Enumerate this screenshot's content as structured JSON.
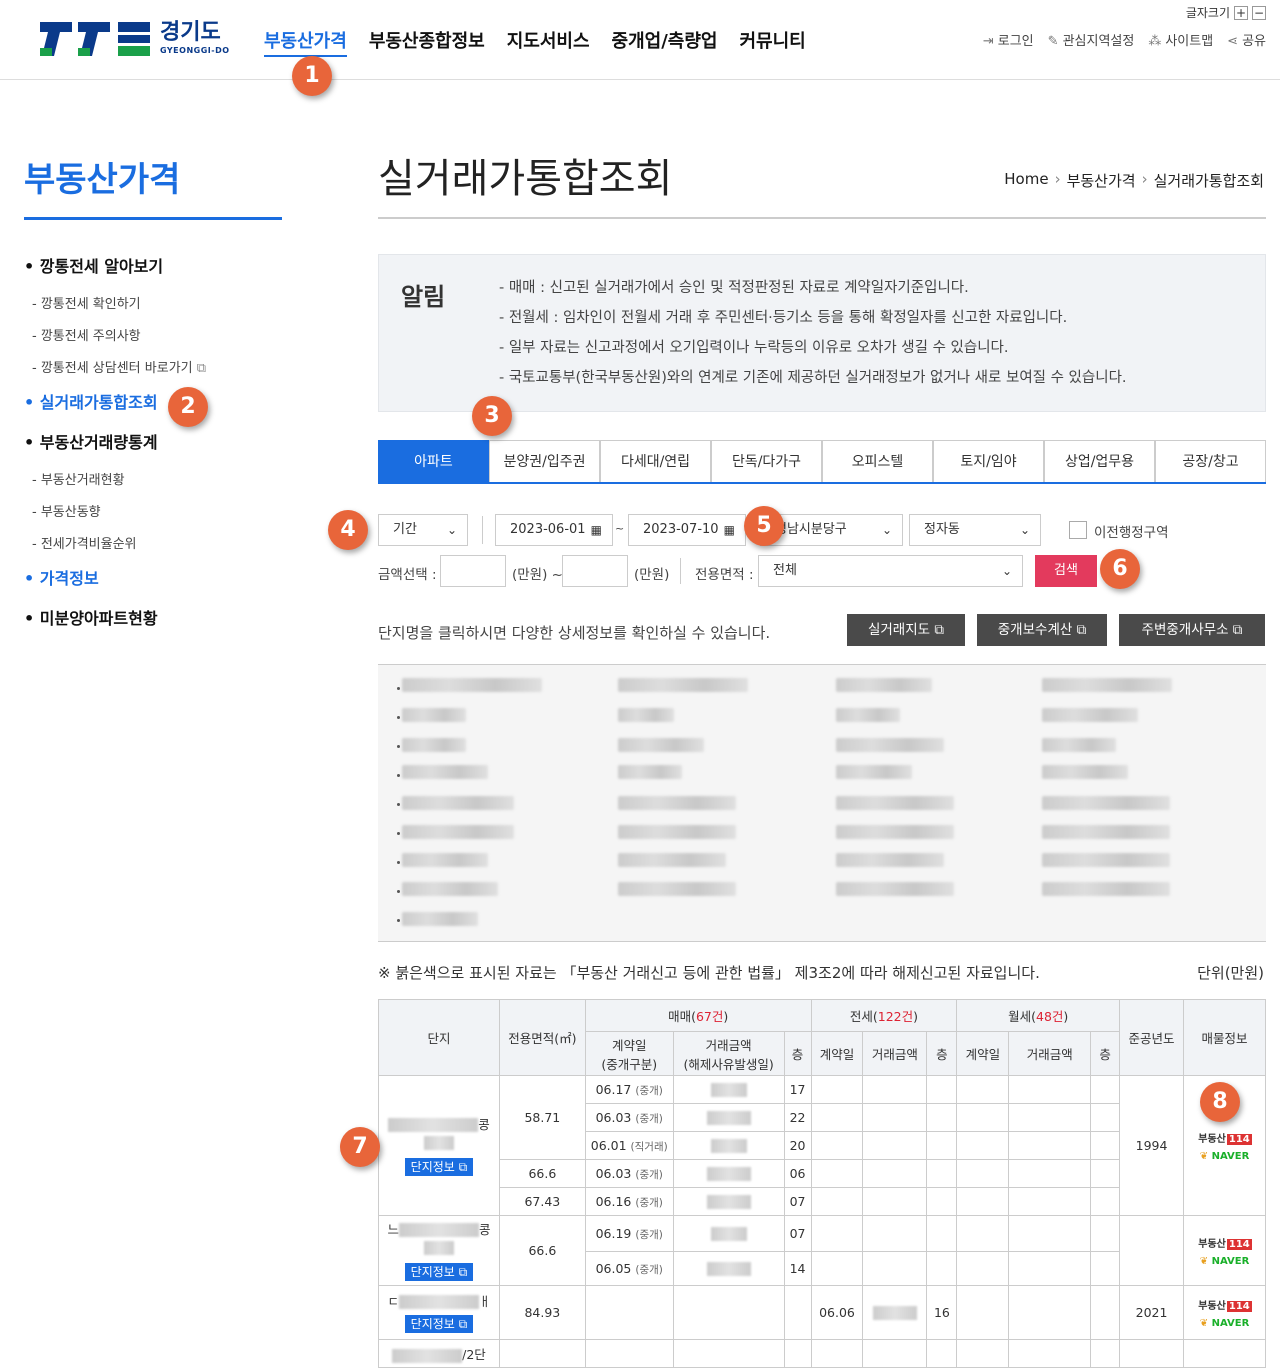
{
  "header": {
    "logo_kr": "경기도",
    "logo_en": "GYEONGGI-DO",
    "gnb": [
      "부동산가격",
      "부동산종합정보",
      "지도서비스",
      "중개업/측량업",
      "커뮤니티"
    ],
    "font_size_label": "글자크기",
    "font_plus": "+",
    "font_minus": "−",
    "util": [
      "로그인",
      "관심지역설정",
      "사이트맵",
      "공유"
    ]
  },
  "lnb": {
    "title": "부동산가격",
    "items": [
      {
        "label": "깡통전세 알아보기",
        "level": 1
      },
      {
        "label": "- 깡통전세 확인하기",
        "level": 2
      },
      {
        "label": "- 깡통전세 주의사항",
        "level": 2
      },
      {
        "label": "- 깡통전세 상담센터 바로가기",
        "level": 2
      },
      {
        "label": "실거래가통합조회",
        "level": 1,
        "active": true
      },
      {
        "label": "부동산거래량통계",
        "level": 1
      },
      {
        "label": "- 부동산거래현황",
        "level": 2
      },
      {
        "label": "- 부동산동향",
        "level": 2
      },
      {
        "label": "- 전세가격비율순위",
        "level": 2
      },
      {
        "label": "가격정보",
        "level": 1,
        "blue": true
      },
      {
        "label": "미분양아파트현황",
        "level": 1
      }
    ]
  },
  "page": {
    "title": "실거래가통합조회",
    "breadcrumb": [
      "Home",
      "부동산가격",
      "실거래가통합조회"
    ]
  },
  "notice": {
    "heading": "알림",
    "lines": [
      "- 매매 : 신고된 실거래가에서 승인 및 적정판정된 자료로 계약일자기준입니다.",
      "- 전월세 : 임차인이 전월세 거래 후 주민센터·등기소 등을 통해 확정일자를 신고한 자료입니다.",
      "- 일부 자료는 신고과정에서 오기입력이나 누락등의 이유로 오차가 생길 수 있습니다.",
      "- 국토교통부(한국부동산원)와의 연계로 기존에 제공하던 실거래정보가 없거나 새로 보여질 수 있습니다."
    ]
  },
  "tabs": [
    "아파트",
    "분양권/입주권",
    "다세대/연립",
    "단독/다가구",
    "오피스텔",
    "토지/임야",
    "상업/업무용",
    "공장/창고"
  ],
  "search": {
    "period_label": "기간",
    "date_from": "2023-06-01",
    "tilde": "~",
    "date_to": "2023-07-10",
    "region": "성남시분당구",
    "dong": "정자동",
    "prev_admin": "이전행정구역",
    "amount_label": "금액선택 :",
    "unit_from": "(만원) ~",
    "unit_to": "(만원)",
    "area_label": "전용면적 :",
    "area_value": "전체",
    "search_button": "검색"
  },
  "hint": "단지명을 클릭하시면 다양한 상세정보를 확인하실 수 있습니다.",
  "buttons": [
    "실거래지도",
    "중개보수계산",
    "주변중개사무소"
  ],
  "legal_note": "※ 붉은색으로 표시된 자료는 「부동산 거래신고 등에 관한 법률」 제3조2에 따라 해제신고된 자료입니다.",
  "unit": "단위(만원)",
  "table": {
    "h_complex": "단지",
    "h_area": "전용면적(㎡)",
    "h_sale": "매매(",
    "sale_count": "67건",
    "h_jeonse": "전세(",
    "jeonse_count": "122건",
    "h_wolse": "월세(",
    "wolse_count": "48건",
    "h_close": ")",
    "h_year": "준공년도",
    "h_info": "매물정보",
    "h_contract": "계약일",
    "h_contract_sub": "(중개구분)",
    "h_price": "거래금액",
    "h_price_sub": "(해제사유발생일)",
    "h_floor": "층",
    "h_contract2": "계약일",
    "h_price2": "거래금액",
    "h_floor2": "층",
    "h_contract3": "계약일",
    "h_price3": "거래금액",
    "h_floor3": "층",
    "complex_btn": "단지정보",
    "rows": [
      {
        "area": "58.71",
        "date": "06.17",
        "type": "(중개)",
        "floor": "17"
      },
      {
        "date": "06.03",
        "type": "(중개)",
        "floor": "22"
      },
      {
        "date": "06.01",
        "type": "(직거래)",
        "floor": "20"
      },
      {
        "area": "66.6",
        "date": "06.03",
        "type": "(중개)",
        "floor": "06"
      },
      {
        "area": "67.43",
        "date": "06.16",
        "type": "(중개)",
        "floor": "07"
      },
      {
        "area": "66.6",
        "date": "06.19",
        "type": "(중개)",
        "floor": "07"
      },
      {
        "date": "06.05",
        "type": "(중개)",
        "floor": "14"
      },
      {
        "area": "84.93",
        "j_date": "06.06",
        "j_floor": "16",
        "year": "2021"
      }
    ],
    "year1": "1994",
    "r114": "부동산",
    "r114_num": "114",
    "naver": "NAVER",
    "complex_frag": [
      "콩",
      "느",
      "콩",
      "ㄷ",
      "ㅐ",
      "/2단"
    ]
  },
  "markers": [
    "1",
    "2",
    "3",
    "4",
    "5",
    "6",
    "7",
    "8"
  ]
}
